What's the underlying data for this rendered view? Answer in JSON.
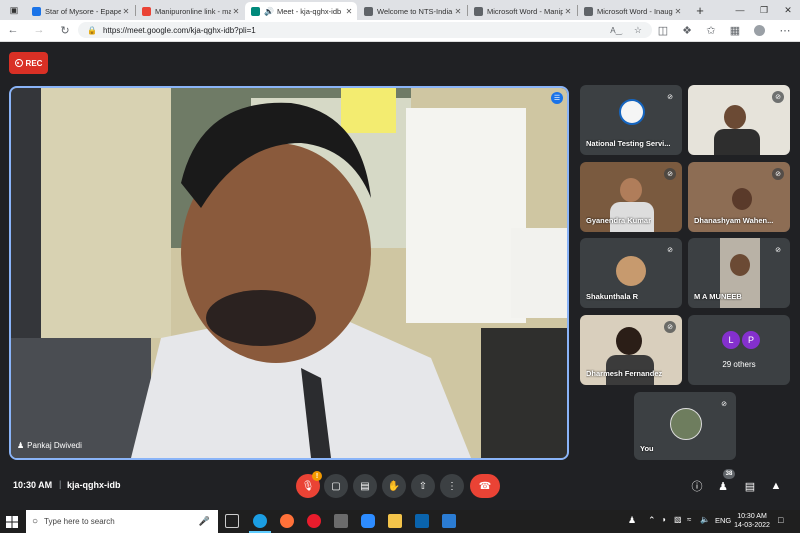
{
  "browser": {
    "tabs": [
      {
        "title": "Star of Mysore - Epaper",
        "active": false,
        "fav_color": "#1a73e8"
      },
      {
        "title": "Manipuronline link - mail",
        "active": false,
        "fav_color": "#ea4335"
      },
      {
        "title": "Meet - kja-qghx-idb",
        "active": true,
        "fav_color": "#00897b"
      },
      {
        "title": "Welcome to NTS-India W",
        "active": false,
        "fav_color": "#5f6368"
      },
      {
        "title": "Microsoft Word - Manip",
        "active": false,
        "fav_color": "#5f6368"
      },
      {
        "title": "Microsoft Word - Inaugu",
        "active": false,
        "fav_color": "#5f6368"
      }
    ],
    "new_tab": "+",
    "url": "https://meet.google.com/kja-qghx-idb?pli=1"
  },
  "meet": {
    "rec_label": "REC",
    "main_speaker": "Pankaj Dwivedi",
    "participants": [
      {
        "name": "National Testing Servi...",
        "kind": "logo"
      },
      {
        "name": "",
        "kind": "video"
      },
      {
        "name": "Gyanendra Kumar",
        "kind": "video"
      },
      {
        "name": "Dhanashyam Wahen...",
        "kind": "video"
      },
      {
        "name": "Shakunthala R",
        "kind": "avatar"
      },
      {
        "name": "M A MUNEEB",
        "kind": "video"
      },
      {
        "name": "Dharmesh Fernandez",
        "kind": "video"
      },
      {
        "name": "29 others",
        "kind": "others"
      }
    ],
    "others_initials": [
      "L",
      "P"
    ],
    "self_name": "You",
    "time": "10:30 AM",
    "separator": "|",
    "meeting_code": "kja-qghx-idb",
    "mic_badge": "!",
    "people_count": "38"
  },
  "taskbar": {
    "search_placeholder": "Type here to search",
    "lang": "ENG",
    "clock_time": "10:30 AM",
    "clock_date": "14-03-2022"
  },
  "colors": {
    "accent_blue": "#8ab4f8",
    "end_call_red": "#ea4335",
    "rec_red": "#d93025",
    "others_avatar": "#8430ce"
  }
}
